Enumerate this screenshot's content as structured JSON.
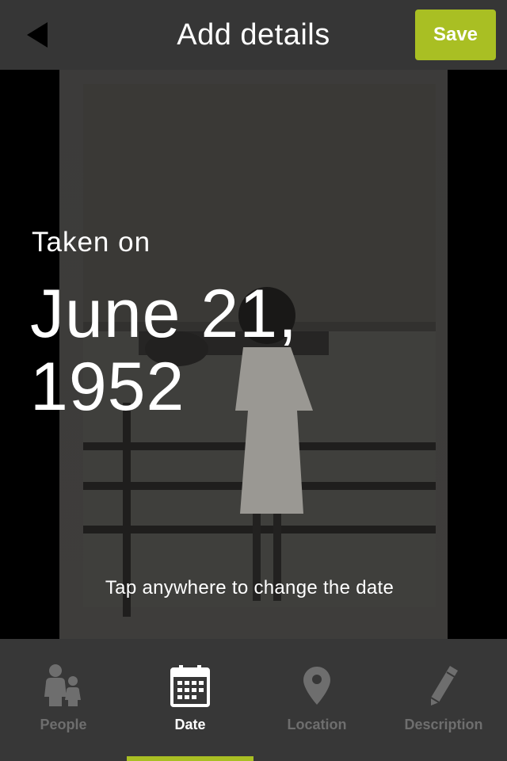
{
  "header": {
    "back_icon": "back-arrow-icon",
    "title": "Add details",
    "save_label": "Save",
    "accent_color": "#a9bf23"
  },
  "photo": {
    "taken_label": "Taken on",
    "date_line1": "June 21,",
    "date_line2": "1952",
    "hint": "Tap anywhere to change the date"
  },
  "tabs": [
    {
      "label": "People",
      "icon": "people-icon",
      "active": false
    },
    {
      "label": "Date",
      "icon": "calendar-icon",
      "active": true
    },
    {
      "label": "Location",
      "icon": "location-pin-icon",
      "active": false
    },
    {
      "label": "Description",
      "icon": "pencil-icon",
      "active": false
    }
  ]
}
